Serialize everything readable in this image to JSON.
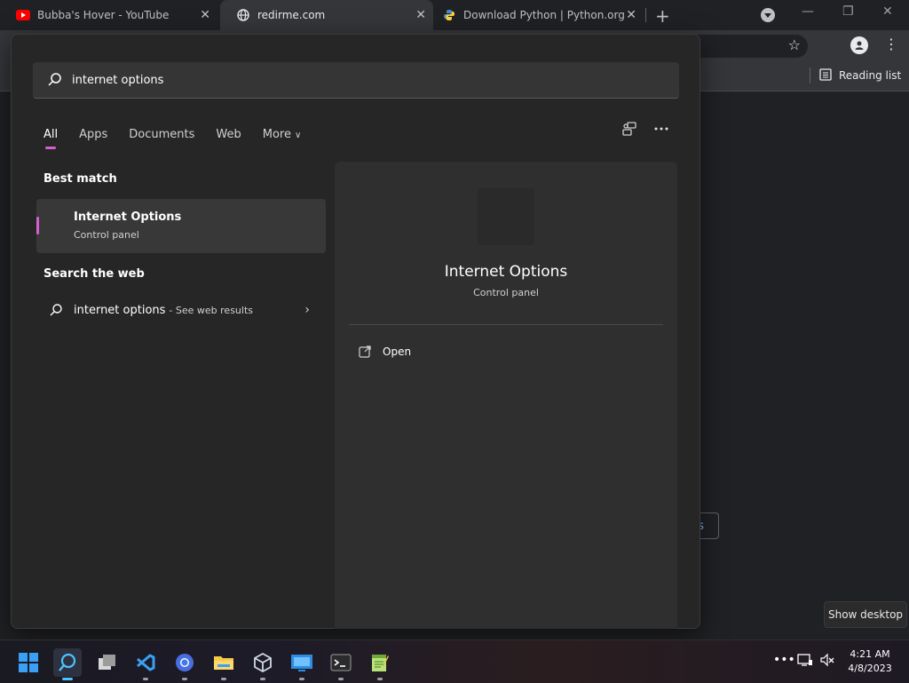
{
  "browser": {
    "tabs": [
      {
        "title": "Bubba's Hover - YouTube",
        "icon": "youtube-icon",
        "active": false
      },
      {
        "title": "redirme.com",
        "icon": "globe-icon",
        "active": true
      },
      {
        "title": "Download Python | Python.org",
        "icon": "python-icon",
        "active": false
      }
    ],
    "reading_list_label": "Reading list",
    "background_button_fragment": "s"
  },
  "search": {
    "query": "internet options",
    "filters": [
      "All",
      "Apps",
      "Documents",
      "Web",
      "More"
    ],
    "active_filter": "All",
    "best_match_heading": "Best match",
    "best_match": {
      "name": "Internet Options",
      "subtitle": "Control panel"
    },
    "web_heading": "Search the web",
    "web_result": {
      "query": "internet options",
      "hint": "- See web results"
    },
    "detail": {
      "name": "Internet Options",
      "subtitle": "Control panel",
      "action_label": "Open"
    }
  },
  "tooltip": {
    "show_desktop": "Show desktop"
  },
  "taskbar": {
    "apps": [
      "start-icon",
      "search-icon",
      "task-view-icon",
      "vscode-icon",
      "chrome-icon",
      "file-explorer-icon",
      "virtualbox-icon",
      "remote-desktop-icon",
      "terminal-icon",
      "notepad-plus-plus-icon"
    ],
    "time": "4:21 AM",
    "date": "4/8/2023"
  },
  "colors": {
    "accent": "#d55fd0",
    "taskbar_indicator": "#4cc2ff",
    "panel_bg": "#262626"
  }
}
